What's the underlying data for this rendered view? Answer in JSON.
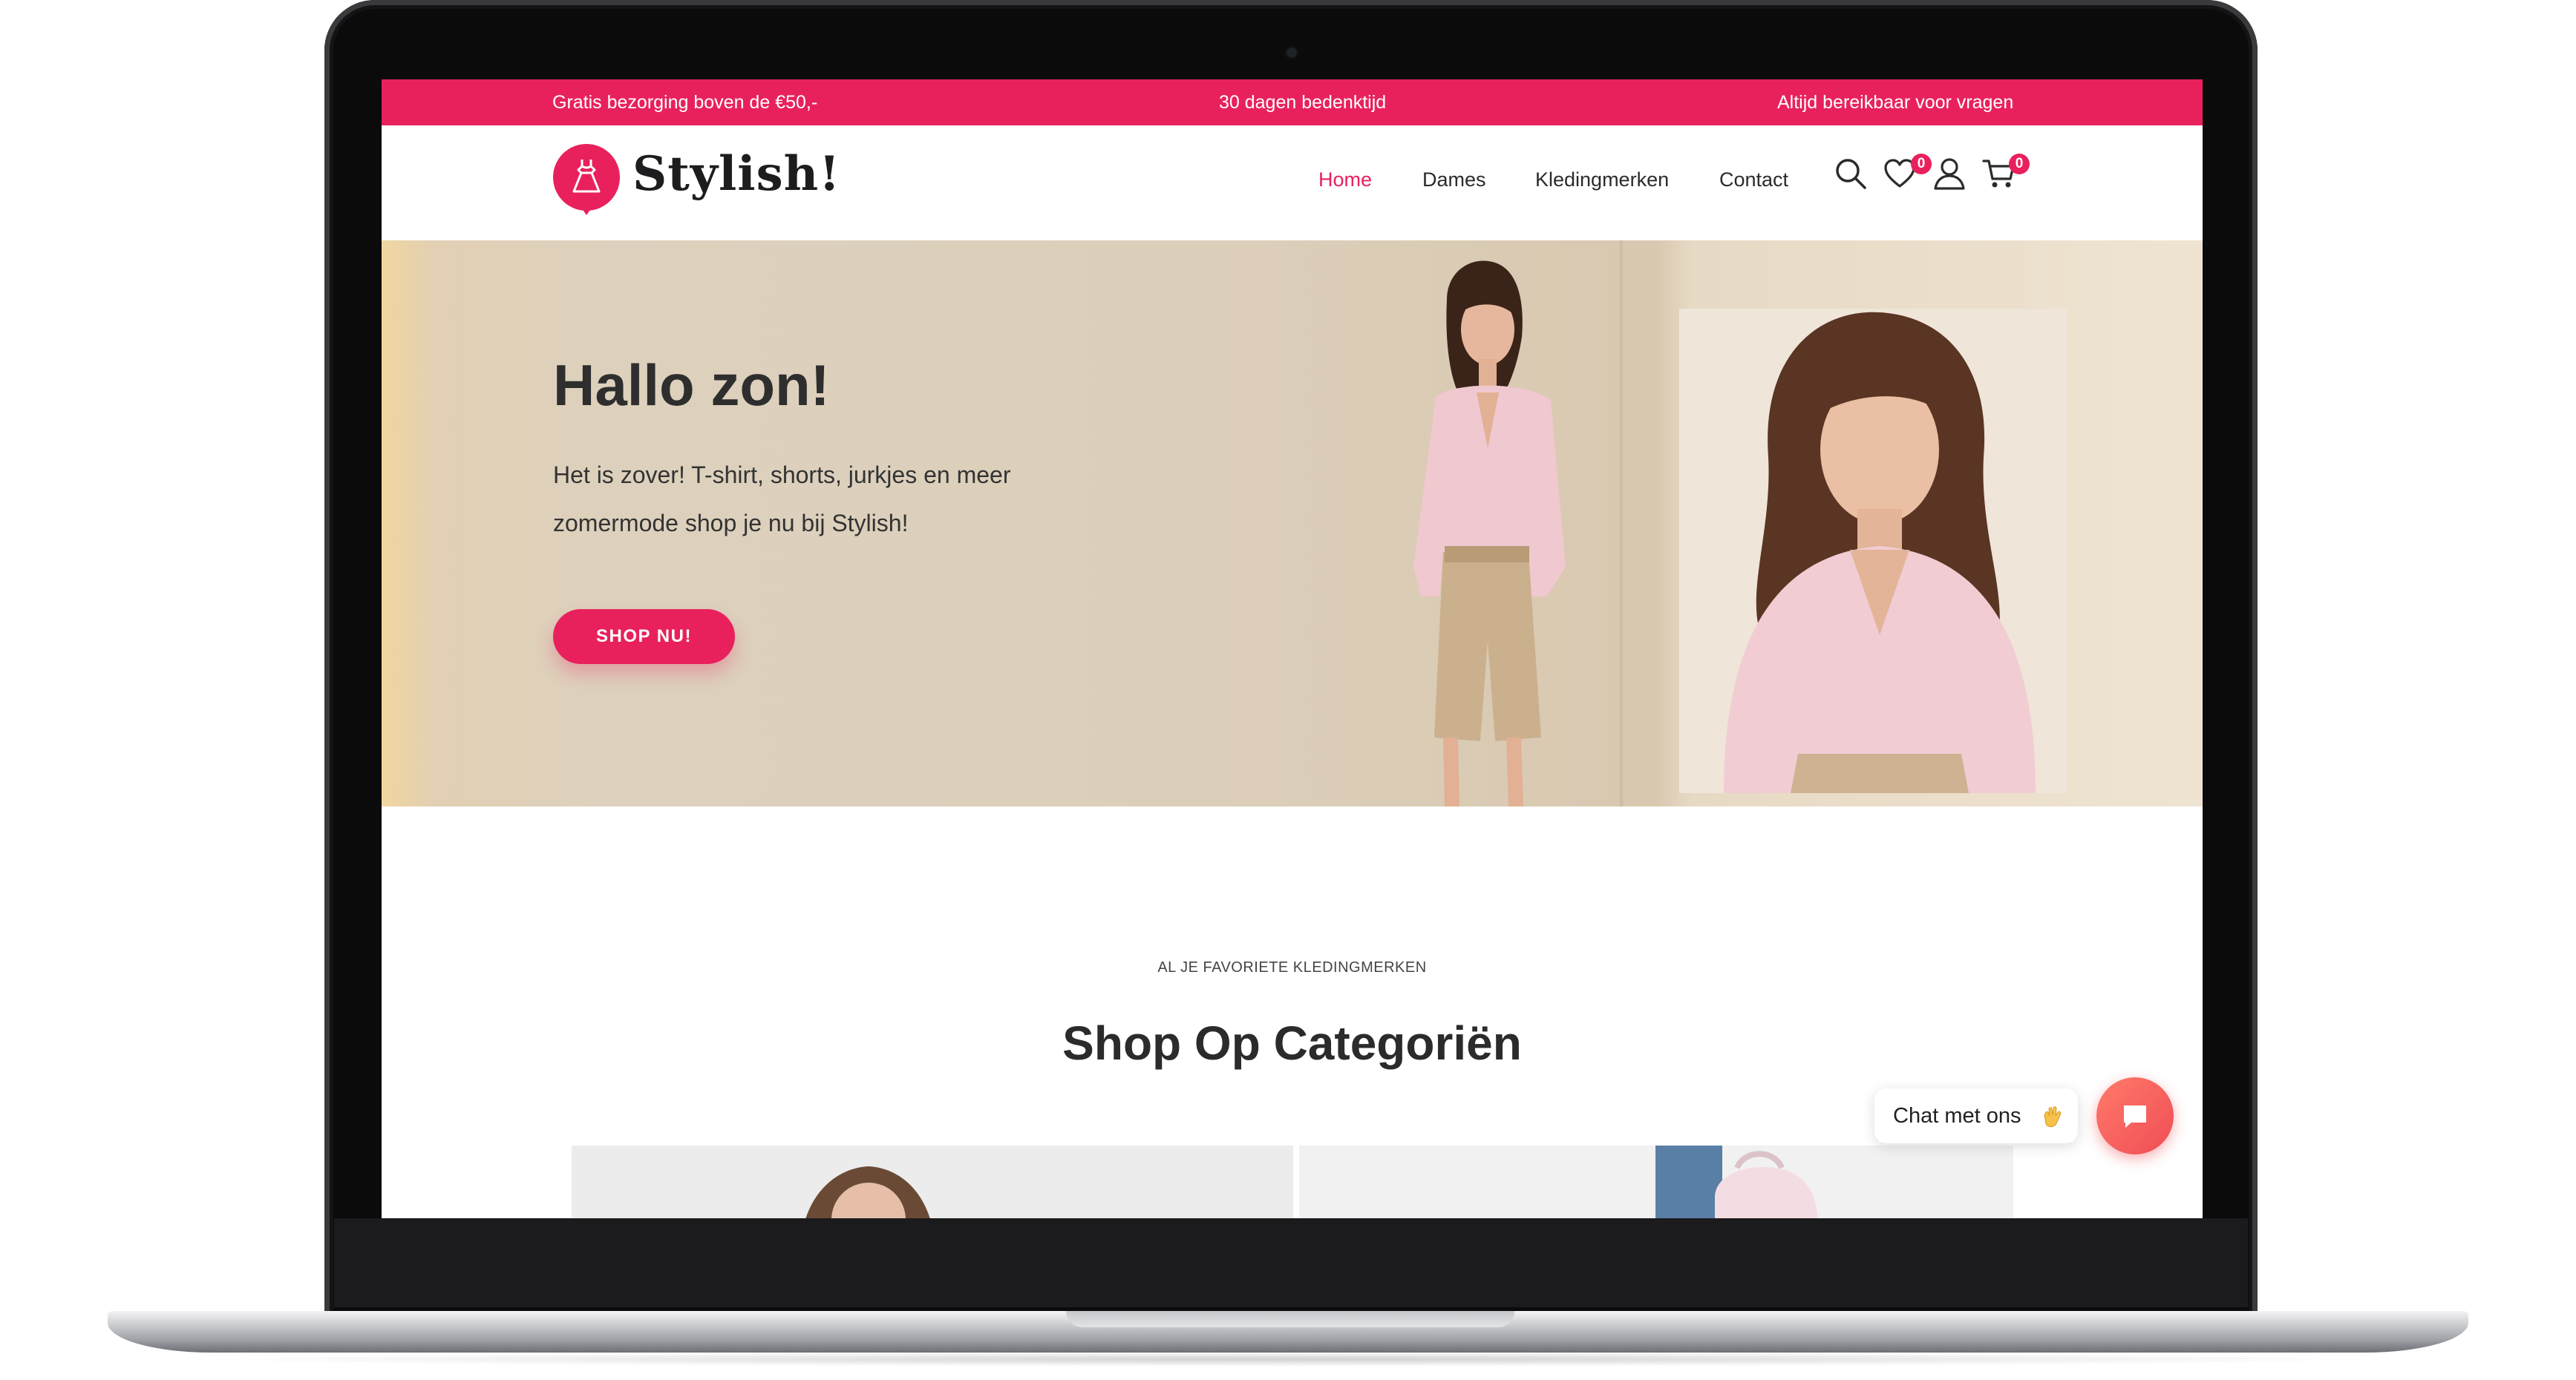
{
  "topbar": {
    "left": "Gratis bezorging boven de €50,-",
    "center": "30 dagen bedenktijd",
    "right": "Altijd bereikbaar voor vragen"
  },
  "brand": {
    "name": "Stylish!",
    "accent_color": "#e8215d"
  },
  "nav": {
    "items": [
      {
        "label": "Home",
        "active": true
      },
      {
        "label": "Dames",
        "active": false
      },
      {
        "label": "Kledingmerken",
        "active": false
      },
      {
        "label": "Contact",
        "active": false
      }
    ]
  },
  "header_icons": {
    "search": "search-icon",
    "wishlist": "heart-icon",
    "wishlist_count": "0",
    "account": "user-icon",
    "cart": "cart-icon",
    "cart_count": "0"
  },
  "hero": {
    "title": "Hallo zon!",
    "text": "Het is zover! T-shirt, shorts, jurkjes en meer zomermode shop je nu bij Stylish!",
    "button_label": "SHOP NU!"
  },
  "categories": {
    "eyebrow": "AL JE FAVORIETE KLEDINGMERKEN",
    "title": "Shop Op Categoriën"
  },
  "chat": {
    "label": "Chat met ons",
    "button_icon": "chat-bubble-icon"
  }
}
